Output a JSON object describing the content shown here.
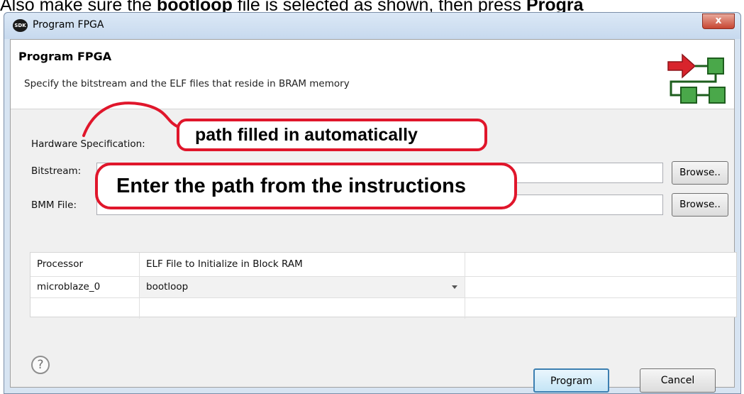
{
  "caption": {
    "prefix": "Also make sure the ",
    "bold_word": "bootloop",
    "middle": " file is selected as shown, then press ",
    "bold_tail": "Progra"
  },
  "window": {
    "title": "Program FPGA",
    "logo_text": "SDK",
    "close_glyph": "x"
  },
  "header": {
    "title": "Program FPGA",
    "description": "Specify the bitstream and the ELF files that reside in BRAM memory"
  },
  "form": {
    "hardware_label": "Hardware Specification:",
    "bitstream_label": "Bitstream:",
    "bitstream_value": "",
    "bmm_label": "BMM File:",
    "bmm_value": "",
    "browse_label": "Browse.."
  },
  "table": {
    "columns": [
      "Processor",
      "ELF File to Initialize in Block RAM",
      ""
    ],
    "rows": [
      {
        "processor": "microblaze_0",
        "elf": "bootloop"
      }
    ]
  },
  "annotations": {
    "callout_auto": "path filled in automatically",
    "callout_enter": "Enter the path from the instructions",
    "color": "#e0162b"
  },
  "footer": {
    "help_glyph": "?",
    "program_label": "Program",
    "cancel_label": "Cancel"
  },
  "icons": {
    "header_icon": "program-fpga-icon",
    "help_icon": "help-icon"
  }
}
